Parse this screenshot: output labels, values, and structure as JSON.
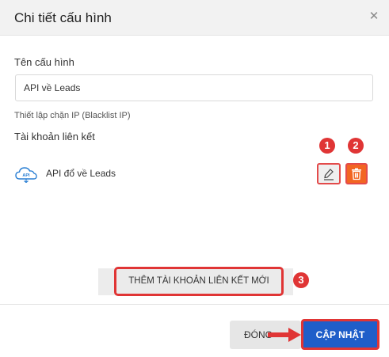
{
  "dialog": {
    "title": "Chi tiết cấu hình",
    "close_icon": "close-icon"
  },
  "form": {
    "name_label": "Tên cấu hình",
    "name_value": "API về Leads",
    "blacklist_link": "Thiết lập chặn IP (Blacklist IP)",
    "linked_accounts_label": "Tài khoản liên kết"
  },
  "linked_accounts": [
    {
      "icon": "cloud-api-icon",
      "icon_text": "API",
      "name": "API đổ về Leads",
      "edit_icon": "pencil-icon",
      "delete_icon": "trash-icon"
    }
  ],
  "annotations": {
    "badge_1": "1",
    "badge_2": "2",
    "badge_3": "3",
    "badge_color": "#e03535"
  },
  "actions": {
    "add_link_label": "THÊM TÀI KHOẢN LIÊN KẾT MỚI",
    "close_label": "ĐÓNG",
    "update_label": "CẬP NHẬT",
    "primary_color": "#1f5ec9",
    "delete_color": "#f26522"
  }
}
